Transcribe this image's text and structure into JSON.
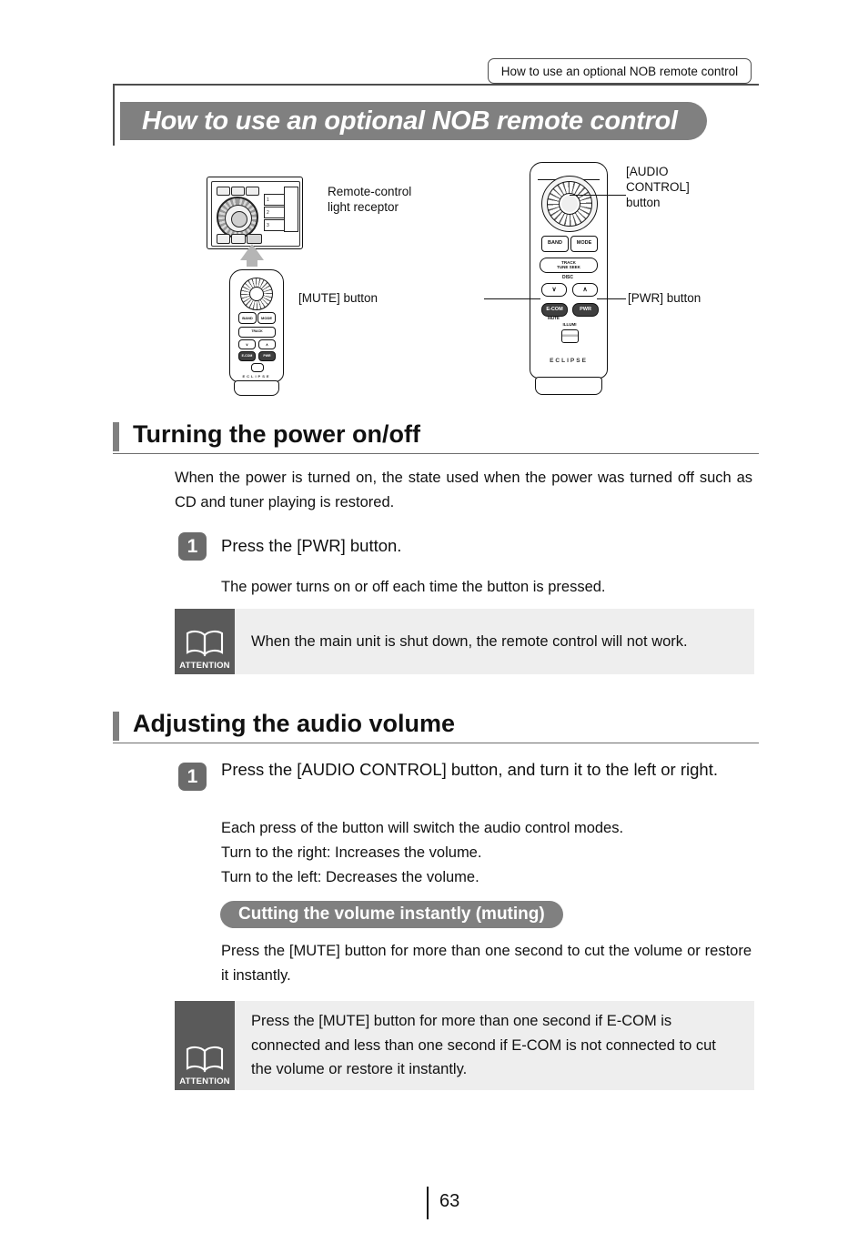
{
  "running_head": "How to use an optional NOB remote control",
  "chapter_title": "How to use an optional NOB remote control",
  "figure": {
    "callouts": {
      "receptor": "Remote-control\nlight receptor",
      "audio_control": "[AUDIO\nCONTROL]\nbutton",
      "mute": "[MUTE] button",
      "pwr": "[PWR] button"
    },
    "head_unit": {
      "preset_1": "1",
      "preset_2": "2",
      "preset_3": "3"
    },
    "remote_keys": {
      "band": "BAND",
      "mode": "MODE",
      "track": "TRACK",
      "tune_seek": "TUNE SEEK",
      "disc": "DISC",
      "down_chevron": "∨",
      "up_chevron": "∧",
      "ecom": "E-COM",
      "mute_sub": "MUTE",
      "pwr": "PWR",
      "illumi": "ILLUMI",
      "brand": "ECLIPSE"
    }
  },
  "sections": [
    {
      "heading": "Turning the power on/off",
      "intro": "When the power is turned on, the state used when the power was turned off such as CD and tuner playing is restored.",
      "step_number": "1",
      "step_text": "Press the [PWR] button.",
      "step_detail": "The power turns on or off each time the button is pressed.",
      "attention": {
        "caption": "ATTENTION",
        "text": "When the main unit is shut down, the remote control will not work."
      }
    },
    {
      "heading": "Adjusting the audio volume",
      "step_number": "1",
      "step_text": "Press the [AUDIO CONTROL] button, and turn it to the left or right.",
      "detail_lines": [
        "Each press of the button will switch the audio control modes.",
        "Turn to the right:  Increases the volume.",
        "Turn to the left:     Decreases the volume."
      ],
      "subheading": "Cutting the volume instantly (muting)",
      "sub_body": "Press the [MUTE] button for more than one second to cut the volume or restore it instantly.",
      "attention": {
        "caption": "ATTENTION",
        "text": "Press the [MUTE] button for more than one second if E-COM is connected and less than one second if E-COM is not connected to cut the volume or restore it instantly."
      }
    }
  ],
  "footer": {
    "page_number": "63"
  },
  "colors": {
    "band_gray": "#808080",
    "badge_gray": "#6b6b6b",
    "attention_icon_gray": "#5a5a5a",
    "attention_bg": "#eeeeee"
  }
}
